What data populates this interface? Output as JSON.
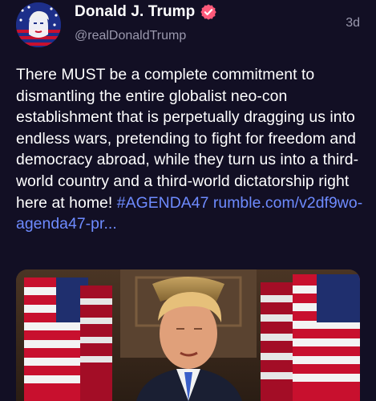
{
  "post": {
    "author": {
      "display_name": "Donald J. Trump",
      "handle": "@realDonaldTrump",
      "verified": true,
      "verified_color": "#ff5a7a",
      "avatar_icon": "flag-portrait-avatar"
    },
    "timestamp": "3d",
    "text": "There MUST be a complete commitment to dismantling the entire globalist neo-con establishment that is perpetually dragging us into endless wars, pretending to fight for freedom and democracy abroad, while they turn us into a third-world country and a third-world dictatorship right here at home!",
    "hashtag": "#AGENDA47",
    "link_text": "rumble.com/v2df9wo-agenda47-pr...",
    "link_color": "#6e8bff",
    "media": {
      "type": "video-thumbnail",
      "description_icon": "speaker-with-flags-thumbnail"
    }
  },
  "theme": {
    "background": "#120f24",
    "text_primary": "#ffffff",
    "text_secondary": "#9a98ad"
  }
}
